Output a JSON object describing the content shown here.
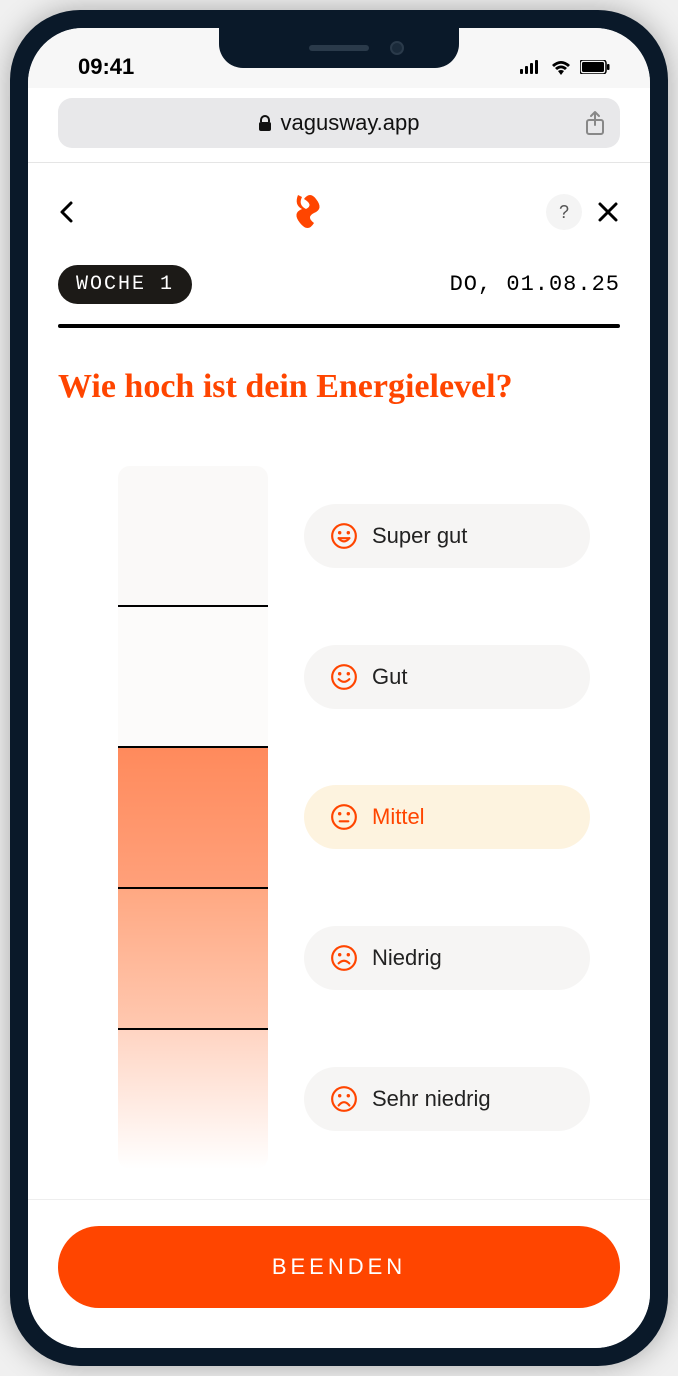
{
  "status": {
    "time": "09:41"
  },
  "browser": {
    "domain": "vagusway.app"
  },
  "header": {
    "help_label": "?"
  },
  "meta": {
    "week_label": "WOCHE 1",
    "date": "DO, 01.08.25"
  },
  "question": "Wie hoch ist dein Energielevel?",
  "options": [
    {
      "label": "Super gut",
      "mood": "grin",
      "selected": false
    },
    {
      "label": "Gut",
      "mood": "smile",
      "selected": false
    },
    {
      "label": "Mittel",
      "mood": "neutral",
      "selected": true
    },
    {
      "label": "Niedrig",
      "mood": "frown",
      "selected": false
    },
    {
      "label": "Sehr niedrig",
      "mood": "sad",
      "selected": false
    }
  ],
  "footer": {
    "end_label": "BEENDEN"
  }
}
